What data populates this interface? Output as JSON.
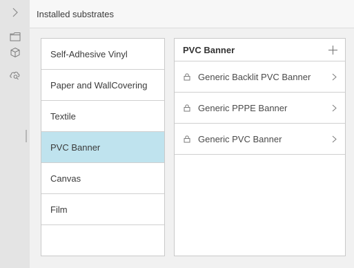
{
  "header": {
    "title": "Installed substrates"
  },
  "rail": {
    "expand_icon": "chevron-right-icon",
    "items": [
      "folder-icon",
      "cube-icon",
      "cloud-search-icon"
    ]
  },
  "categories": [
    {
      "label": "Self-Adhesive Vinyl",
      "selected": false
    },
    {
      "label": "Paper and WallCovering",
      "selected": false
    },
    {
      "label": "Textile",
      "selected": false
    },
    {
      "label": "PVC Banner",
      "selected": true
    },
    {
      "label": "Canvas",
      "selected": false
    },
    {
      "label": "Film",
      "selected": false
    }
  ],
  "detail": {
    "title": "PVC Banner",
    "add_icon": "plus-icon",
    "items": [
      {
        "label": "Generic Backlit PVC Banner",
        "icon": "lock-icon"
      },
      {
        "label": "Generic PPPE Banner",
        "icon": "lock-icon"
      },
      {
        "label": "Generic PVC Banner",
        "icon": "lock-icon"
      }
    ]
  },
  "colors": {
    "selected_bg": "#bfe3ee",
    "rail_bg": "#e4e4e4",
    "page_bg": "#f1f1f1"
  }
}
